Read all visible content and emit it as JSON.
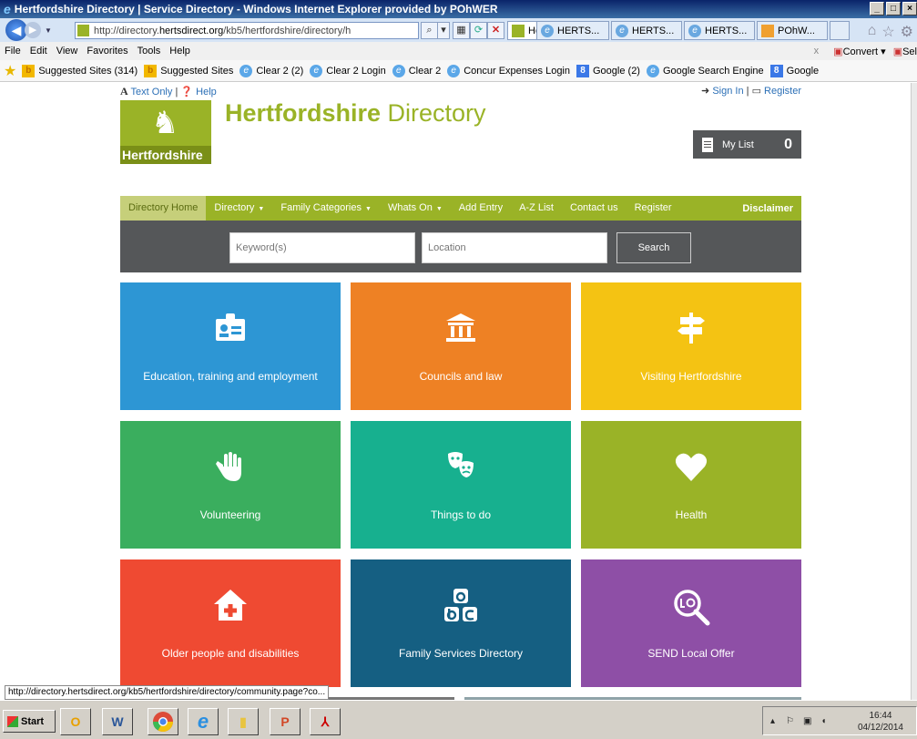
{
  "window": {
    "title": "Hertfordshire Directory | Service Directory - Windows Internet Explorer provided by POhWER"
  },
  "address_bar": {
    "url_prefix": "http://directory.",
    "url_domain": "hertsdirect.org",
    "url_rest": "/kb5/hertfordshire/directory/h"
  },
  "tabs": [
    {
      "label": "Her...",
      "active": true
    },
    {
      "label": "HERTS..."
    },
    {
      "label": "HERTS..."
    },
    {
      "label": "HERTS..."
    },
    {
      "label": "POhW..."
    }
  ],
  "menu": {
    "items": [
      "File",
      "Edit",
      "View",
      "Favorites",
      "Tools",
      "Help"
    ],
    "convert_label": "Convert",
    "select_label": "Sel"
  },
  "favorites": [
    {
      "label": "Suggested Sites (314)",
      "icon": "bing"
    },
    {
      "label": "Suggested Sites",
      "icon": "bing"
    },
    {
      "label": "Clear 2 (2)",
      "icon": "ie"
    },
    {
      "label": "Clear 2 Login",
      "icon": "ie"
    },
    {
      "label": "Clear 2",
      "icon": "ie"
    },
    {
      "label": "Concur Expenses Login",
      "icon": "ie"
    },
    {
      "label": "Google (2)",
      "icon": "google"
    },
    {
      "label": "Google Search Engine",
      "icon": "ie"
    },
    {
      "label": "Google",
      "icon": "google"
    }
  ],
  "page": {
    "text_only": "Text Only",
    "help": "Help",
    "sign_in": "Sign In",
    "register_link": "Register",
    "logo_name": "Hertfordshire",
    "site_title_bold": "Hertfordshire",
    "site_title_rest": " Directory",
    "my_list_label": "My List",
    "my_list_count": "0",
    "nav": [
      {
        "label": "Directory Home",
        "active": true,
        "dropdown": false
      },
      {
        "label": "Directory",
        "dropdown": true
      },
      {
        "label": "Family Categories",
        "dropdown": true
      },
      {
        "label": "Whats On",
        "dropdown": true
      },
      {
        "label": "Add Entry",
        "dropdown": false
      },
      {
        "label": "A-Z List",
        "dropdown": false
      },
      {
        "label": "Contact us",
        "dropdown": false
      },
      {
        "label": "Register",
        "dropdown": false
      }
    ],
    "disclaimer": "Disclaimer",
    "search": {
      "keyword_placeholder": "Keyword(s)",
      "location_placeholder": "Location",
      "button_label": "Search"
    },
    "tiles": [
      {
        "label": "Education, training and employment",
        "color": "#2d96d4",
        "icon": "id-card-icon"
      },
      {
        "label": "Councils and law",
        "color": "#ee8124",
        "icon": "courthouse-icon"
      },
      {
        "label": "Visiting Hertfordshire",
        "color": "#f4c313",
        "icon": "signpost-icon"
      },
      {
        "label": "Volunteering",
        "color": "#3aae5e",
        "icon": "hand-icon"
      },
      {
        "label": "Things to do",
        "color": "#17b08f",
        "icon": "theatre-masks-icon"
      },
      {
        "label": "Health",
        "color": "#9ab327",
        "icon": "heart-icon"
      },
      {
        "label": "Older people and disabilities",
        "color": "#ef4a32",
        "icon": "house-cross-icon"
      },
      {
        "label": "Family Services Directory",
        "color": "#155f82",
        "icon": "abc-blocks-icon"
      },
      {
        "label": "SEND Local Offer",
        "color": "#8e4fa6",
        "icon": "magnifier-lo-icon"
      }
    ]
  },
  "status_url": "http://directory.hertsdirect.org/kb5/hertfordshire/directory/community.page?co...",
  "taskbar": {
    "start_label": "Start",
    "time": "16:44",
    "date": "04/12/2014"
  }
}
